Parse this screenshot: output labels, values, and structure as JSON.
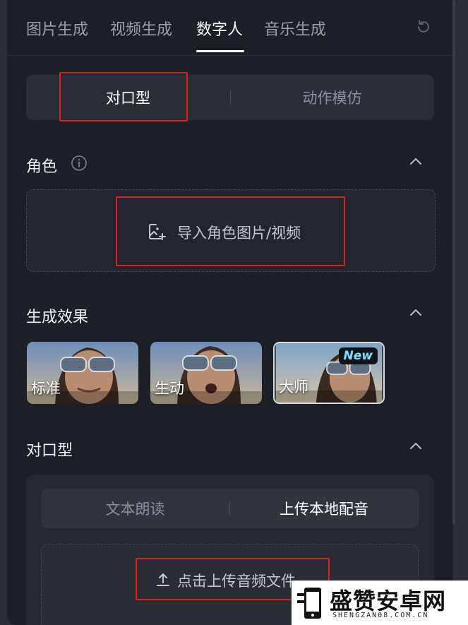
{
  "tabs": {
    "items": [
      "图片生成",
      "视频生成",
      "数字人",
      "音乐生成"
    ],
    "active": "数字人",
    "refresh_icon": "refresh-icon"
  },
  "mode_toggle": {
    "options": [
      "对口型",
      "动作模仿"
    ],
    "active": "对口型"
  },
  "role_section": {
    "title": "角色",
    "info_icon": "info-icon",
    "upload_label": "导入角色图片/视频",
    "upload_icon": "image-add-icon"
  },
  "effect_section": {
    "title": "生成效果",
    "options": [
      {
        "label": "标准",
        "selected": false
      },
      {
        "label": "生动",
        "selected": false
      },
      {
        "label": "大师",
        "selected": true,
        "badge": "New"
      }
    ]
  },
  "lipsync_section": {
    "title": "对口型",
    "source_options": [
      "文本朗读",
      "上传本地配音"
    ],
    "active": "上传本地配音",
    "upload_label": "点击上传音频文件",
    "upload_icon": "upload-icon"
  },
  "watermark": {
    "title": "盛赞安卓网",
    "url": "SHENGZAN08.COM.CN"
  },
  "colors": {
    "background": "#1c1f26",
    "highlight": "#d9231f",
    "badge_text": "#7fe0ff"
  }
}
